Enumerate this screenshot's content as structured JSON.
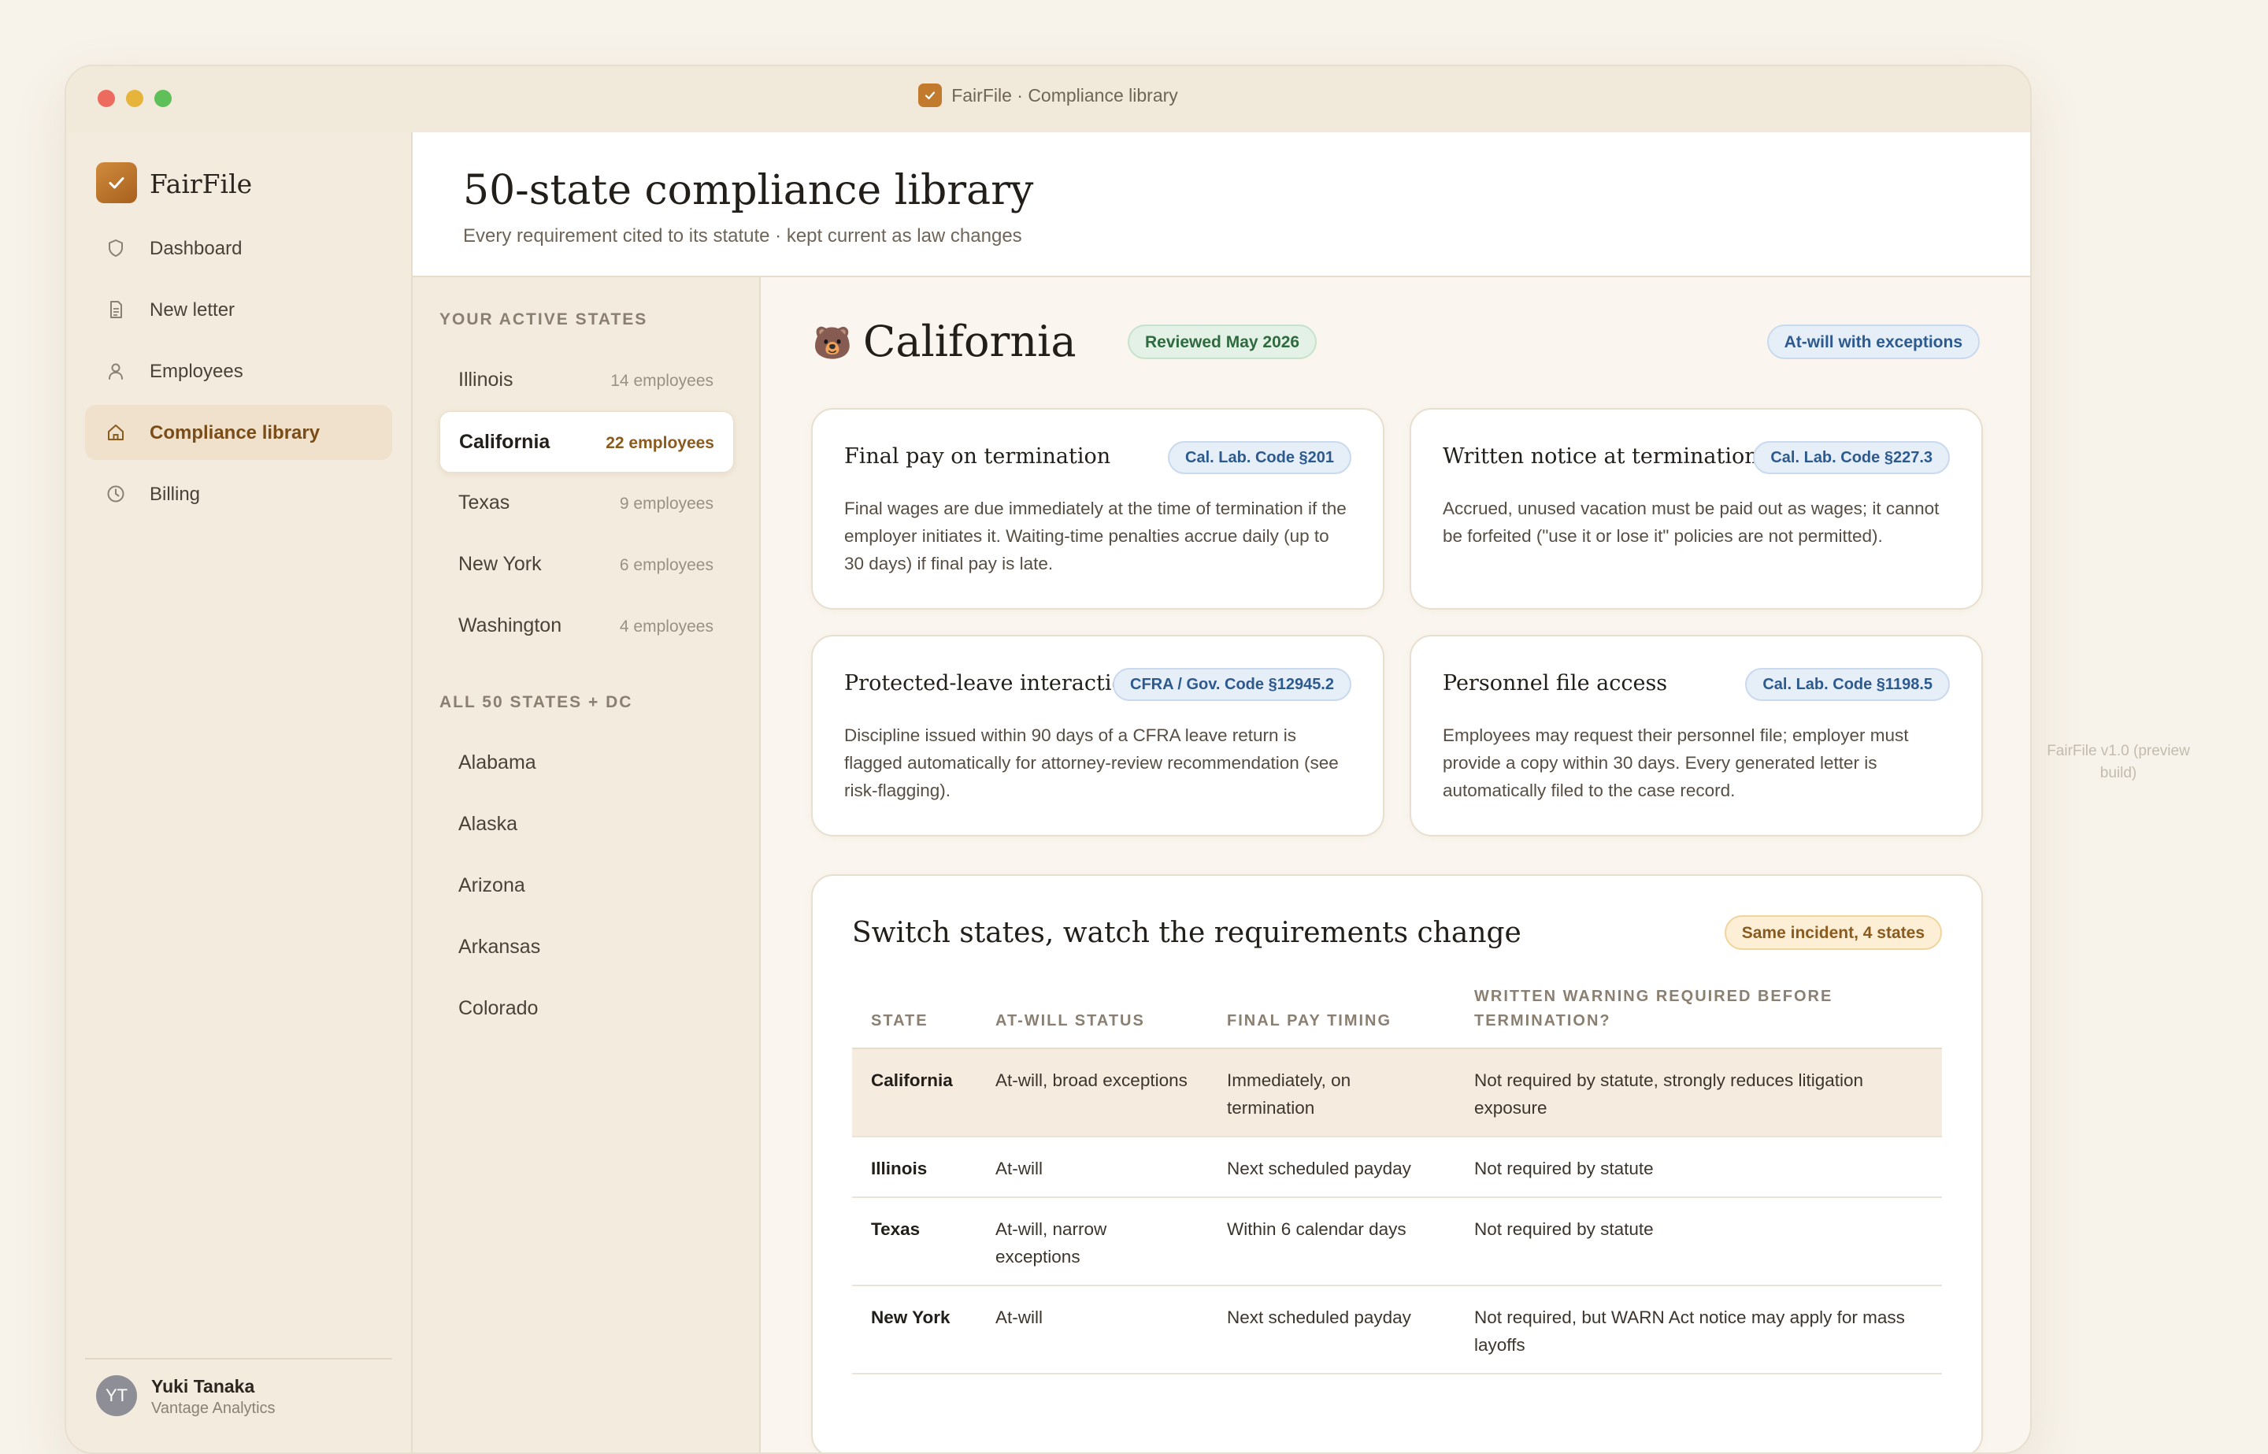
{
  "window": {
    "title": "FairFile · Compliance library"
  },
  "sidebar": {
    "brand": "FairFile",
    "nav": [
      {
        "label": "Dashboard",
        "icon": "shield-icon"
      },
      {
        "label": "New letter",
        "icon": "document-icon"
      },
      {
        "label": "Employees",
        "icon": "person-icon"
      },
      {
        "label": "Compliance library",
        "icon": "home-icon",
        "active": true
      },
      {
        "label": "Billing",
        "icon": "clock-icon"
      }
    ],
    "user": {
      "initials": "YT",
      "name": "Yuki Tanaka",
      "org": "Vantage Analytics"
    }
  },
  "header": {
    "title": "50-state compliance library",
    "subtitle": "Every requirement cited to its statute · kept current as law changes"
  },
  "states": {
    "active_label": "YOUR ACTIVE STATES",
    "active": [
      {
        "name": "Illinois",
        "count": "14 employees"
      },
      {
        "name": "California",
        "count": "22 employees",
        "selected": true
      },
      {
        "name": "Texas",
        "count": "9 employees"
      },
      {
        "name": "New York",
        "count": "6 employees"
      },
      {
        "name": "Washington",
        "count": "4 employees"
      }
    ],
    "all_label": "ALL 50 STATES + DC",
    "all": [
      "Alabama",
      "Alaska",
      "Arizona",
      "Arkansas",
      "Colorado"
    ]
  },
  "detail": {
    "emoji": "🐻",
    "state": "California",
    "reviewed": "Reviewed May 2026",
    "status": "At-will with exceptions",
    "cards": [
      {
        "title": "Final pay on termination",
        "tag": "Cal. Lab. Code §201",
        "body": "Final wages are due immediately at the time of termination if the employer initiates it. Waiting-time penalties accrue daily (up to 30 days) if final pay is late."
      },
      {
        "title": "Written notice at termination",
        "tag": "Cal. Lab. Code §227.3",
        "body": "Accrued, unused vacation must be paid out as wages; it cannot be forfeited (\"use it or lose it\" policies are not permitted)."
      },
      {
        "title": "Protected-leave interaction",
        "tag": "CFRA / Gov. Code §12945.2",
        "body": "Discipline issued within 90 days of a CFRA leave return is flagged automatically for attorney-review recommendation (see risk-flagging)."
      },
      {
        "title": "Personnel file access",
        "tag": "Cal. Lab. Code §1198.5",
        "body": "Employees may request their personnel file; employer must provide a copy within 30 days. Every generated letter is automatically filed to the case record."
      }
    ]
  },
  "comparison": {
    "title": "Switch states, watch the requirements change",
    "badge": "Same incident, 4 states",
    "columns": [
      "STATE",
      "AT-WILL STATUS",
      "FINAL PAY TIMING",
      "WRITTEN WARNING REQUIRED BEFORE TERMINATION?"
    ],
    "rows": [
      [
        "California",
        "At-will, broad exceptions",
        "Immediately, on termination",
        "Not required by statute, strongly reduces litigation exposure"
      ],
      [
        "Illinois",
        "At-will",
        "Next scheduled payday",
        "Not required by statute"
      ],
      [
        "Texas",
        "At-will, narrow exceptions",
        "Within 6 calendar days",
        "Not required by statute"
      ],
      [
        "New York",
        "At-will",
        "Next scheduled payday",
        "Not required, but WARN Act notice may apply for mass layoffs"
      ]
    ]
  },
  "footer": {
    "version": "FairFile v1.0 (preview build)"
  }
}
